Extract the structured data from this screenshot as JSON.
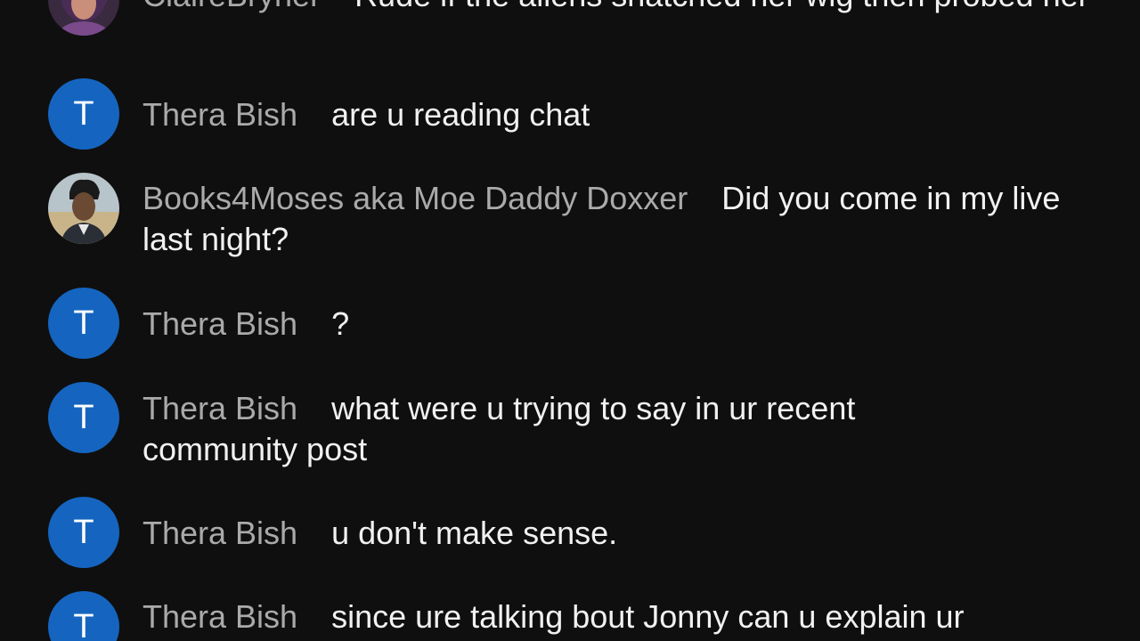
{
  "colors": {
    "background": "#0f0f0f",
    "author": "#aaaaaa",
    "message": "#f1f1f1",
    "letter_avatar": "#1565c0"
  },
  "messages": [
    {
      "author": "ClaireBryner",
      "avatar": "photo-woman",
      "text": "Rude if the aliens snatched her wig then probed her"
    },
    {
      "author": "Thera Bish",
      "avatar_letter": "T",
      "text": "are u reading chat"
    },
    {
      "author": "Books4Moses aka Moe Daddy Doxxer",
      "avatar": "photo-man",
      "text": "Did you come in my live last night?"
    },
    {
      "author": "Thera Bish",
      "avatar_letter": "T",
      "text": "?"
    },
    {
      "author": "Thera Bish",
      "avatar_letter": "T",
      "text": "what were u trying to say in ur recent community post"
    },
    {
      "author": "Thera Bish",
      "avatar_letter": "T",
      "text": "u don't make sense."
    },
    {
      "author": "Thera Bish",
      "avatar_letter": "T",
      "text": "since ure talking bout Jonny can u explain ur"
    }
  ]
}
